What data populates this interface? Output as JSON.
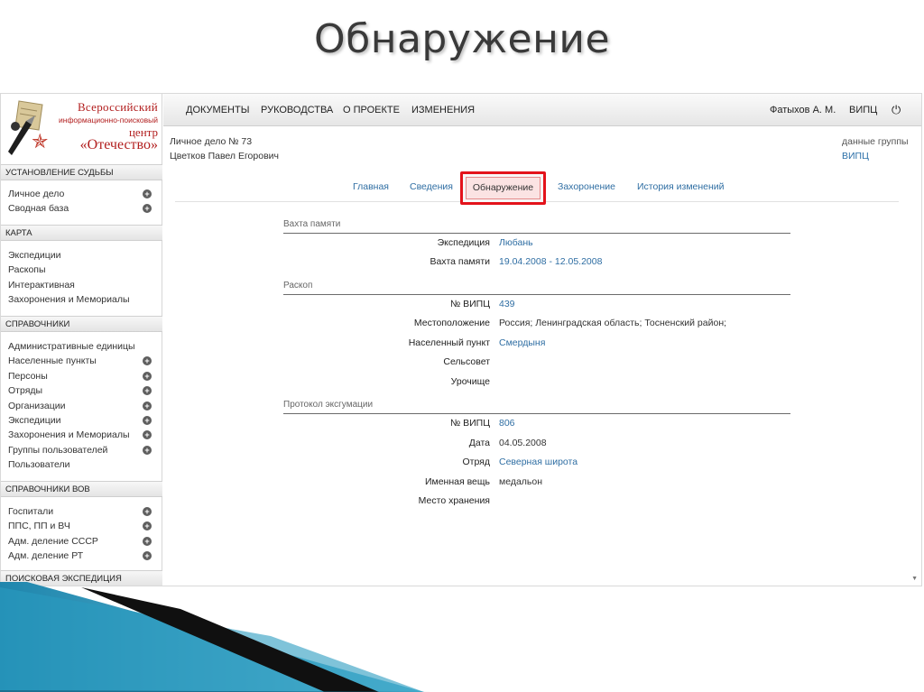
{
  "slide_title": "Обнаружение",
  "logo": {
    "line1": "Всероссийский",
    "line2": "информационно-поисковый",
    "line3": "центр",
    "line4": "«Отечество»"
  },
  "sidebar": {
    "sections": [
      {
        "header": "УСТАНОВЛЕНИЕ СУДЬБЫ",
        "items": [
          {
            "label": "Личное дело",
            "plus": true
          },
          {
            "label": "Сводная база",
            "plus": true
          }
        ]
      },
      {
        "header": "КАРТА",
        "items": [
          {
            "label": "Экспедиции",
            "plus": false
          },
          {
            "label": "Раскопы",
            "plus": false
          },
          {
            "label": "Интерактивная",
            "plus": false
          },
          {
            "label": "Захоронения и Мемориалы",
            "plus": false
          }
        ]
      },
      {
        "header": "СПРАВОЧНИКИ",
        "items": [
          {
            "label": "Административные единицы",
            "plus": false
          },
          {
            "label": "Населенные пункты",
            "plus": true
          },
          {
            "label": "Персоны",
            "plus": true
          },
          {
            "label": "Отряды",
            "plus": true
          },
          {
            "label": "Организации",
            "plus": true
          },
          {
            "label": "Экспедиции",
            "plus": true
          },
          {
            "label": "Захоронения и Мемориалы",
            "plus": true
          },
          {
            "label": "Группы пользователей",
            "plus": true
          },
          {
            "label": "Пользователи",
            "plus": false
          }
        ]
      },
      {
        "header": "СПРАВОЧНИКИ ВОВ",
        "items": [
          {
            "label": "Госпитали",
            "plus": true
          },
          {
            "label": "ППС, ПП и ВЧ",
            "plus": true
          },
          {
            "label": "Адм. деление СССР",
            "plus": true
          },
          {
            "label": "Адм. деление РТ",
            "plus": true
          }
        ]
      },
      {
        "header": "ПОИСКОВАЯ ЭКСПЕДИЦИЯ",
        "items": []
      }
    ]
  },
  "topnav": {
    "items": [
      "ДОКУМЕНТЫ",
      "РУКОВОДСТВА",
      "О ПРОЕКТЕ",
      "ИЗМЕНЕНИЯ"
    ],
    "user": "Фатыхов А. М.",
    "org": "ВИПЦ",
    "power_icon": "⏻"
  },
  "card": {
    "title": "Личное дело № 73",
    "name": "Цветков Павел Егорович",
    "group_label": "данные группы",
    "group_value": "ВИПЦ"
  },
  "tabs": {
    "items": [
      "Главная",
      "Сведения",
      "Обнаружение",
      "Захоронение",
      "История изменений"
    ],
    "active": "Обнаружение"
  },
  "groups": [
    {
      "title": "Вахта памяти",
      "rows": [
        {
          "label": "Экспедиция",
          "value": "Любань",
          "link": true
        },
        {
          "label": "Вахта памяти",
          "value": "19.04.2008 - 12.05.2008",
          "link": true
        }
      ]
    },
    {
      "title": "Раскоп",
      "rows": [
        {
          "label": "№ ВИПЦ",
          "value": "439",
          "link": true
        },
        {
          "label": "Местоположение",
          "value": "Россия; Ленинградская область; Тосненский район;",
          "link": false
        },
        {
          "label": "Населенный пункт",
          "value": "Смердыня",
          "link": true
        },
        {
          "label": "Сельсовет",
          "value": "",
          "link": false
        },
        {
          "label": "Урочище",
          "value": "",
          "link": false
        }
      ]
    },
    {
      "title": "Протокол эксгумации",
      "rows": [
        {
          "label": "№ ВИПЦ",
          "value": "806",
          "link": true
        },
        {
          "label": "Дата",
          "value": "04.05.2008",
          "link": false
        },
        {
          "label": "Отряд",
          "value": "Северная широта",
          "link": true
        },
        {
          "label": "Именная вещь",
          "value": "медальон",
          "link": false
        },
        {
          "label": "Место хранения",
          "value": "",
          "link": false
        }
      ]
    }
  ],
  "colors": {
    "link": "#2f6ea3",
    "highlight_border": "#e3131b",
    "logo_red": "#b21e1e",
    "wedge_blue": "#2a9bc0"
  }
}
